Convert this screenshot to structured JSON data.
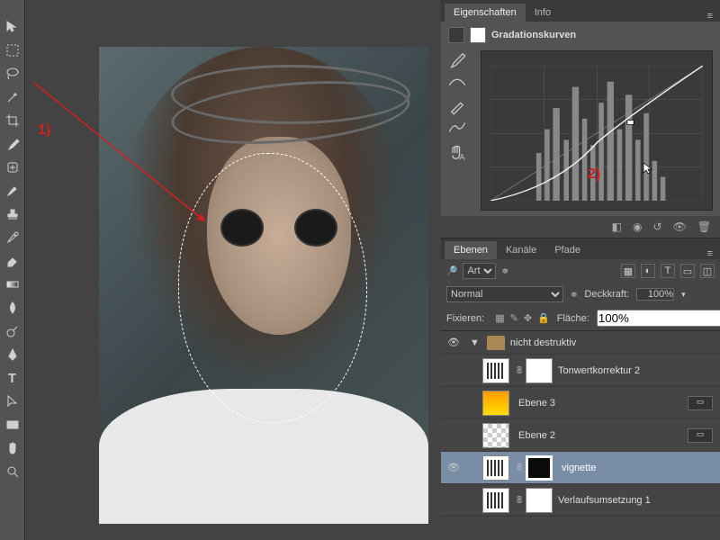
{
  "annotations": {
    "a1": "1)",
    "a2": "2)"
  },
  "panels": {
    "properties": {
      "tabs": [
        "Eigenschaften",
        "Info"
      ],
      "title": "Gradationskurven",
      "footer_icons": [
        "clip-icon",
        "view-icon",
        "reset-icon",
        "visibility-icon",
        "trash-icon"
      ]
    },
    "layers": {
      "tabs": [
        "Ebenen",
        "Kanäle",
        "Pfade"
      ],
      "kind_label": "Art",
      "blend_label": "Normal",
      "opacity_label": "Deckkraft:",
      "opacity_value": "100%",
      "lock_label": "Fixieren:",
      "fill_label": "Fläche:",
      "fill_value": "100%",
      "group": "nicht destruktiv",
      "items": [
        {
          "name": "Tonwertkorrektur 2",
          "thumb": "adj",
          "mask": true,
          "fx": false,
          "vis": false
        },
        {
          "name": "Ebene 3",
          "thumb": "grad",
          "mask": false,
          "fx": true,
          "vis": false
        },
        {
          "name": "Ebene 2",
          "thumb": "checker",
          "mask": false,
          "fx": true,
          "vis": false
        },
        {
          "name": "vignette",
          "thumb": "adj",
          "mask": "dark",
          "fx": false,
          "vis": true,
          "sel": true
        },
        {
          "name": "Verlaufsumsetzung 1",
          "thumb": "adj",
          "mask": true,
          "fx": false,
          "vis": false
        }
      ]
    }
  },
  "chart_data": {
    "type": "line",
    "title": "Gradationskurven",
    "xlabel": "",
    "ylabel": "",
    "xlim": [
      0,
      255
    ],
    "ylim": [
      0,
      255
    ],
    "series": [
      {
        "name": "curve",
        "x": [
          0,
          64,
          128,
          168,
          255
        ],
        "y": [
          0,
          40,
          110,
          148,
          255
        ]
      }
    ],
    "control_point": {
      "x": 168,
      "y": 148
    },
    "histogram_peaks_x": [
      60,
      75,
      90,
      110,
      130,
      150,
      165,
      180,
      200
    ]
  }
}
